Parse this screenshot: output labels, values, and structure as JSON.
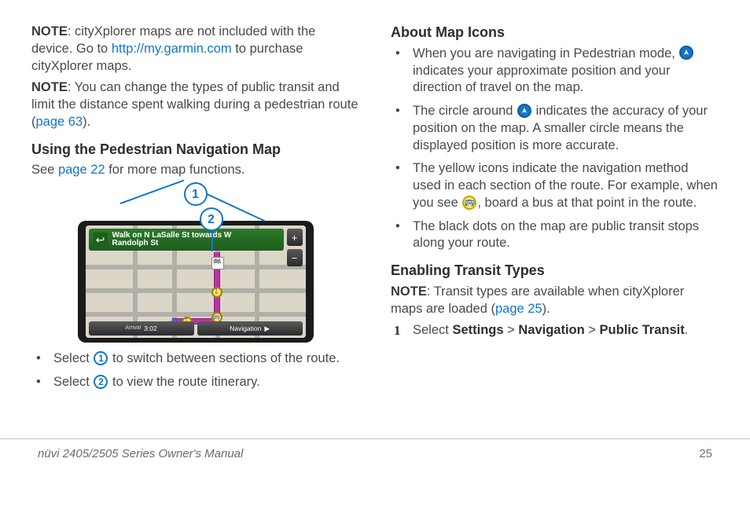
{
  "left": {
    "note1": {
      "label": "NOTE",
      "before": ": cityXplorer maps are not included with the device. Go to ",
      "link_text": "http://my.garmin.com",
      "after": " to purchase cityXplorer maps."
    },
    "note2": {
      "label": "NOTE",
      "text_before": ": You can change the types of public transit and limit the distance spent walking during a pedestrian route (",
      "link_text": "page 63",
      "text_after": ")."
    },
    "section1_heading": "Using the Pedestrian Navigation Map",
    "see_text_before": "See ",
    "see_link": "page 22",
    "see_text_after": " for more map functions.",
    "figure": {
      "callout1": "1",
      "callout2": "2",
      "turn_line1": "Walk on N LaSalle St towards W",
      "turn_line2": "Randolph St",
      "btn_plus": "+",
      "btn_minus": "−",
      "bottom_left_label": "Arrival",
      "bottom_left_value": "3:02",
      "bottom_right_label": "Navigation",
      "bottom_right_arrow": "▶"
    },
    "bullets": [
      {
        "before": "Select ",
        "marker": "1",
        "after": " to switch between sections of the route."
      },
      {
        "before": "Select ",
        "marker": "2",
        "after": " to view the route itinerary."
      }
    ]
  },
  "right": {
    "section2_heading": "About Map Icons",
    "bullets": [
      {
        "pre": "When you are navigating in Pedestrian mode, ",
        "icon": "pos",
        "post": " indicates your approximate position and your direction of travel on the map."
      },
      {
        "pre": "The circle around ",
        "icon": "pos",
        "post": " indicates the accuracy of your position on the map. A smaller circle means the displayed position is more accurate."
      },
      {
        "pre": "The yellow icons indicate the navigation method used in each section of the route. For example, when you see ",
        "icon": "bus",
        "post": ", board a bus at that point in the route."
      },
      {
        "pre": "The black dots on the map are public transit stops along your route.",
        "icon": "",
        "post": ""
      }
    ],
    "section3_heading": "Enabling Transit Types",
    "note3": {
      "label": "NOTE",
      "before": ": Transit types are available when cityXplorer maps are loaded (",
      "link": "page 25",
      "after": ")."
    },
    "step1": {
      "num": "1",
      "t1": "Select ",
      "b1": "Settings",
      "s1": " > ",
      "b2": "Navigation",
      "s2": " > ",
      "b3": "Public Transit",
      "end": "."
    }
  },
  "footer": {
    "left": "nüvi 2405/2505 Series Owner's Manual",
    "right": "25"
  }
}
